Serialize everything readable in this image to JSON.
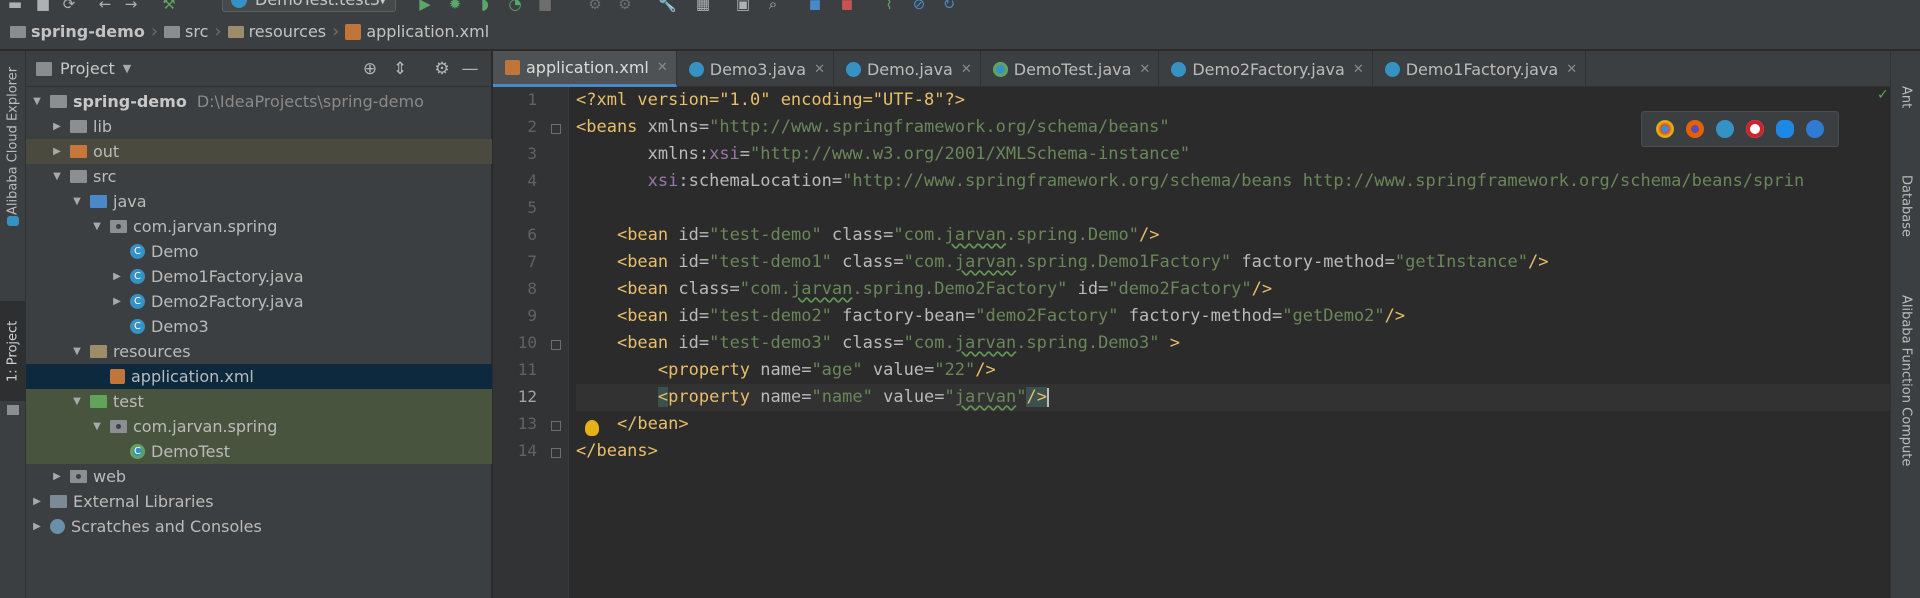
{
  "toolbar": {
    "run_config": "DemoTest.test3",
    "icons": [
      "open-icon",
      "save-icon",
      "sync-icon",
      "back-icon",
      "forward-icon",
      "build-icon",
      "run-icon",
      "debug-icon",
      "coverage-icon",
      "profile-icon",
      "stop-icon",
      "attach-icon",
      "settings-icon",
      "structure-icon",
      "terminal-icon",
      "search-icon",
      "translate-icon",
      "translate-alt-icon",
      "stats-icon",
      "block-icon",
      "sync-alt-icon"
    ]
  },
  "breadcrumb": {
    "items": [
      "spring-demo",
      "src",
      "resources",
      "application.xml"
    ]
  },
  "left_stripe": {
    "cloud_explorer": "Alibaba Cloud Explorer",
    "project_tab": "1: Project"
  },
  "project_panel": {
    "title": "Project",
    "tree": [
      {
        "label": "spring-demo",
        "path": "D:\\IdeaProjects\\spring-demo"
      },
      {
        "label": "lib"
      },
      {
        "label": "out"
      },
      {
        "label": "src"
      },
      {
        "label": "java"
      },
      {
        "label": "com.jarvan.spring"
      },
      {
        "label": "Demo"
      },
      {
        "label": "Demo1Factory.java"
      },
      {
        "label": "Demo2Factory.java"
      },
      {
        "label": "Demo3"
      },
      {
        "label": "resources"
      },
      {
        "label": "application.xml"
      },
      {
        "label": "test"
      },
      {
        "label": "com.jarvan.spring"
      },
      {
        "label": "DemoTest"
      },
      {
        "label": "web"
      },
      {
        "label": "External Libraries"
      },
      {
        "label": "Scratches and Consoles"
      }
    ]
  },
  "editor": {
    "tabs": [
      {
        "label": "application.xml",
        "active": true
      },
      {
        "label": "Demo3.java"
      },
      {
        "label": "Demo.java"
      },
      {
        "label": "DemoTest.java"
      },
      {
        "label": "Demo2Factory.java"
      },
      {
        "label": "Demo1Factory.java"
      }
    ],
    "line_numbers": [
      "1",
      "2",
      "3",
      "4",
      "5",
      "6",
      "7",
      "8",
      "9",
      "10",
      "11",
      "12",
      "13",
      "14"
    ],
    "current_line": "12",
    "code": {
      "l1": "<?xml version=\"1.0\" encoding=\"UTF-8\"?>",
      "l2_tag": "<beans",
      "l2_attr": " xmlns=",
      "l2_val": "\"http://www.springframework.org/schema/beans\"",
      "l3_attr": "xmlns:",
      "l3_ns": "xsi",
      "l3_val": "\"http://www.w3.org/2001/XMLSchema-instance\"",
      "l4_ns": "xsi",
      "l4_attr": ":schemaLocation=",
      "l4_val": "\"http://www.springframework.org/schema/beans http://www.springframework.org/schema/beans/sprin",
      "l6": [
        "<bean",
        " id=",
        "\"test-demo\"",
        " class=",
        "\"com.",
        "jarvan",
        ".spring.Demo\"",
        "/>"
      ],
      "l7": [
        "<bean",
        " id=",
        "\"test-demo1\"",
        " class=",
        "\"com.",
        "jarvan",
        ".spring.Demo1Factory\"",
        " factory-method=",
        "\"getInstance\"",
        "/>"
      ],
      "l8": [
        "<bean",
        " class=",
        "\"com.",
        "jarvan",
        ".spring.Demo2Factory\"",
        " id=",
        "\"demo2Factory\"",
        "/>"
      ],
      "l9": [
        "<bean",
        " id=",
        "\"test-demo2\"",
        " factory-bean=",
        "\"demo2Factory\"",
        " factory-method=",
        "\"getDemo2\"",
        "/>"
      ],
      "l10": [
        "<bean",
        " id=",
        "\"test-demo3\"",
        " class=",
        "\"com.",
        "jarvan",
        ".spring.Demo3\"",
        " >"
      ],
      "l11": [
        "<property",
        " name=",
        "\"age\"",
        " value=",
        "\"22\"",
        "/>"
      ],
      "l12": [
        "<",
        "property",
        " name=",
        "\"name\"",
        " value=",
        "\"",
        "jarvan",
        "\"",
        "/>"
      ],
      "l13": "</bean>",
      "l14": "</beans>"
    }
  },
  "browser_icons": [
    "chrome-icon",
    "firefox-icon",
    "safari-icon",
    "opera-icon",
    "ie-icon",
    "edge-icon"
  ],
  "right_stripe": {
    "ant": "Ant",
    "database": "Database",
    "function_compute": "Alibaba Function Compute"
  },
  "colors": {
    "tag": "#e8bf6a",
    "attr": "#bababa",
    "value": "#6a8759",
    "namespace": "#9876aa",
    "selection": "#0d293e"
  }
}
